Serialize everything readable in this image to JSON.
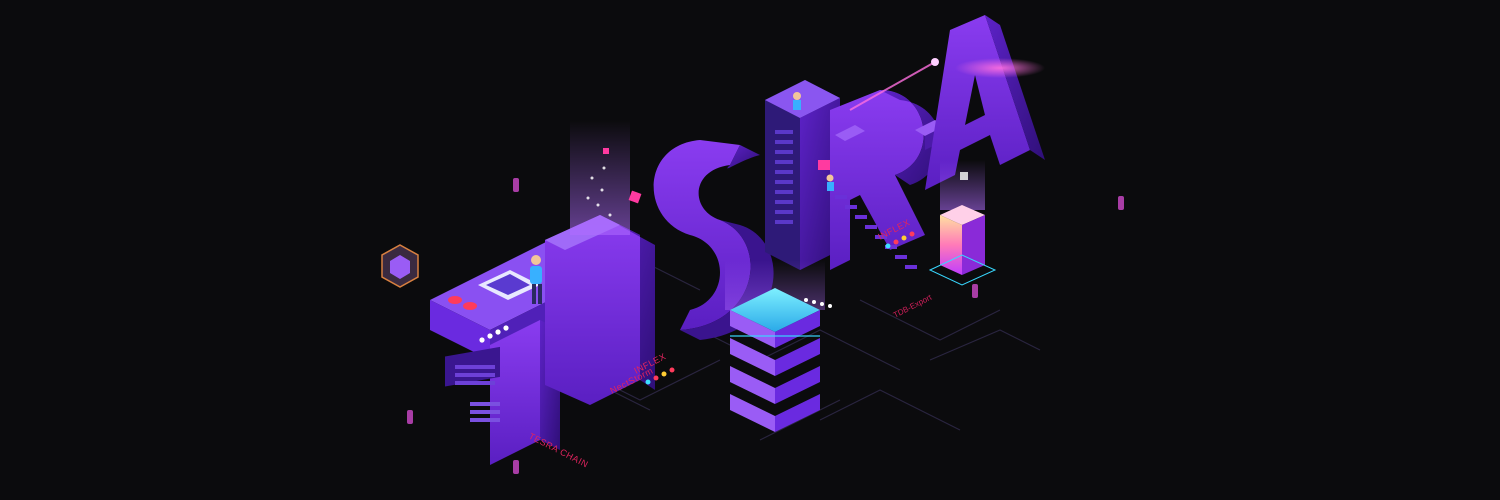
{
  "artwork": {
    "letters": "TESRA"
  },
  "labels": {
    "tesra_chain": "TESRA CHAIN",
    "inflex_left": "INFLEX",
    "nectstorm": "NectStorm",
    "inflex_right": "INFLEX",
    "tdb_label": "TDB-Export"
  },
  "colors": {
    "background": "#0b0b0d",
    "purple_face": "#7a2ee8",
    "purple_side": "#4b1aa8",
    "purple_top": "#9a5cf5",
    "cyan": "#38d8ff",
    "magenta": "#e0245e"
  }
}
